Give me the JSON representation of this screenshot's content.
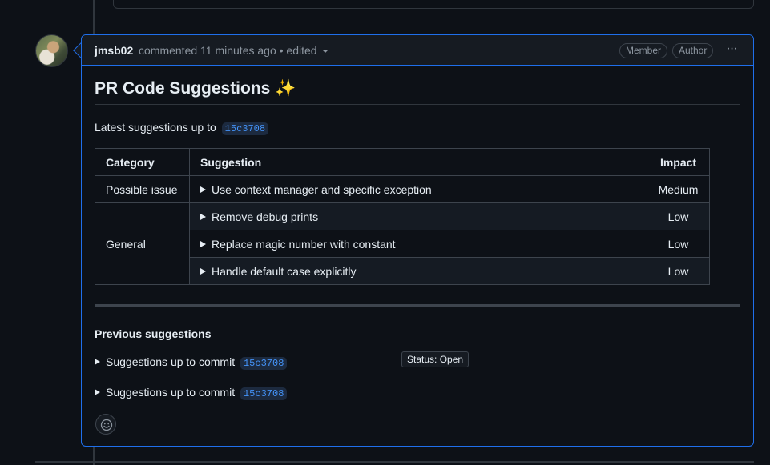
{
  "comment": {
    "author": "jmsb02",
    "meta": "commented 11 minutes ago • edited",
    "badges": [
      "Member",
      "Author"
    ],
    "menu_label": "···"
  },
  "body": {
    "title": "PR Code Suggestions ✨",
    "latest_prefix": "Latest suggestions up to",
    "latest_sha": "15c3708",
    "table": {
      "headers": [
        "Category",
        "Suggestion",
        "Impact"
      ],
      "rows": [
        {
          "category": "Possible issue",
          "suggestion": "Use context manager and specific exception",
          "impact": "Medium"
        },
        {
          "category": "General",
          "suggestion": "Remove debug prints",
          "impact": "Low"
        },
        {
          "category": "",
          "suggestion": "Replace magic number with constant",
          "impact": "Low"
        },
        {
          "category": "",
          "suggestion": "Handle default case explicitly",
          "impact": "Low"
        }
      ]
    },
    "previous": {
      "title": "Previous suggestions",
      "items": [
        {
          "label": "Suggestions up to commit",
          "sha": "15c3708"
        },
        {
          "label": "Suggestions up to commit",
          "sha": "15c3708"
        }
      ]
    },
    "tooltip": "Status: Open"
  },
  "colors": {
    "background": "#0d1117",
    "border_accent": "#1f6feb",
    "link": "#4493f8",
    "muted": "#8d96a0"
  }
}
